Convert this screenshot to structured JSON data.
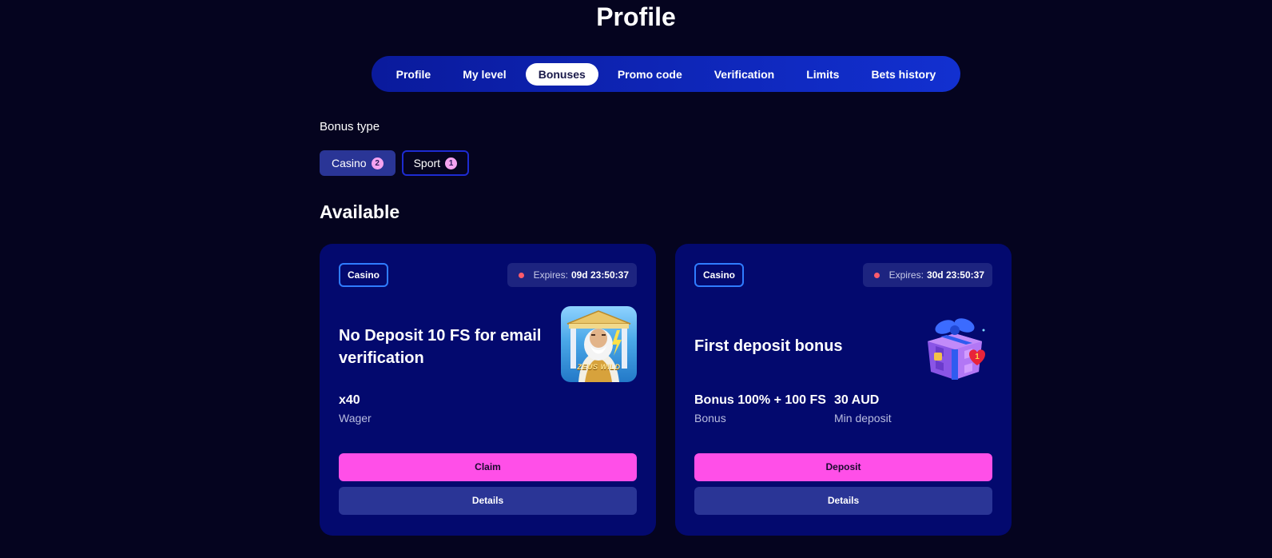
{
  "page": {
    "title": "Profile"
  },
  "tabs": [
    {
      "label": "Profile"
    },
    {
      "label": "My level"
    },
    {
      "label": "Bonuses",
      "active": true
    },
    {
      "label": "Promo code"
    },
    {
      "label": "Verification"
    },
    {
      "label": "Limits"
    },
    {
      "label": "Bets history"
    }
  ],
  "bonus_type": {
    "label": "Bonus type",
    "filters": [
      {
        "label": "Casino",
        "count": "2",
        "selected": true
      },
      {
        "label": "Sport",
        "count": "1",
        "selected": false
      }
    ]
  },
  "available": {
    "title": "Available",
    "cards": [
      {
        "tag": "Casino",
        "expires_label": "Expires:",
        "expires_value": "09d 23:50:37",
        "title": "No Deposit 10 FS for email verification",
        "image_icon": "zeus-slot-thumbnail",
        "image_caption": "ZEUS WILD",
        "stats": [
          {
            "value": "x40",
            "label": "Wager"
          }
        ],
        "primary_button": "Claim",
        "secondary_button": "Details"
      },
      {
        "tag": "Casino",
        "expires_label": "Expires:",
        "expires_value": "30d 23:50:37",
        "title": "First deposit bonus",
        "image_icon": "gift-box-icon",
        "gift_badge": "1",
        "stats": [
          {
            "value": "Bonus 100% + 100 FS",
            "label": "Bonus"
          },
          {
            "value": "30 AUD",
            "label": "Min deposit"
          }
        ],
        "primary_button": "Deposit",
        "secondary_button": "Details"
      }
    ]
  },
  "colors": {
    "background": "#05041f",
    "card": "#03096e",
    "accent_pink": "#ff4fe8",
    "secondary_button": "#2a3596",
    "tab_bar_start": "#0a1a9c",
    "tab_bar_end": "#1230d0",
    "tag_border": "#2f7cff",
    "expire_dot": "#ff5b6b"
  }
}
